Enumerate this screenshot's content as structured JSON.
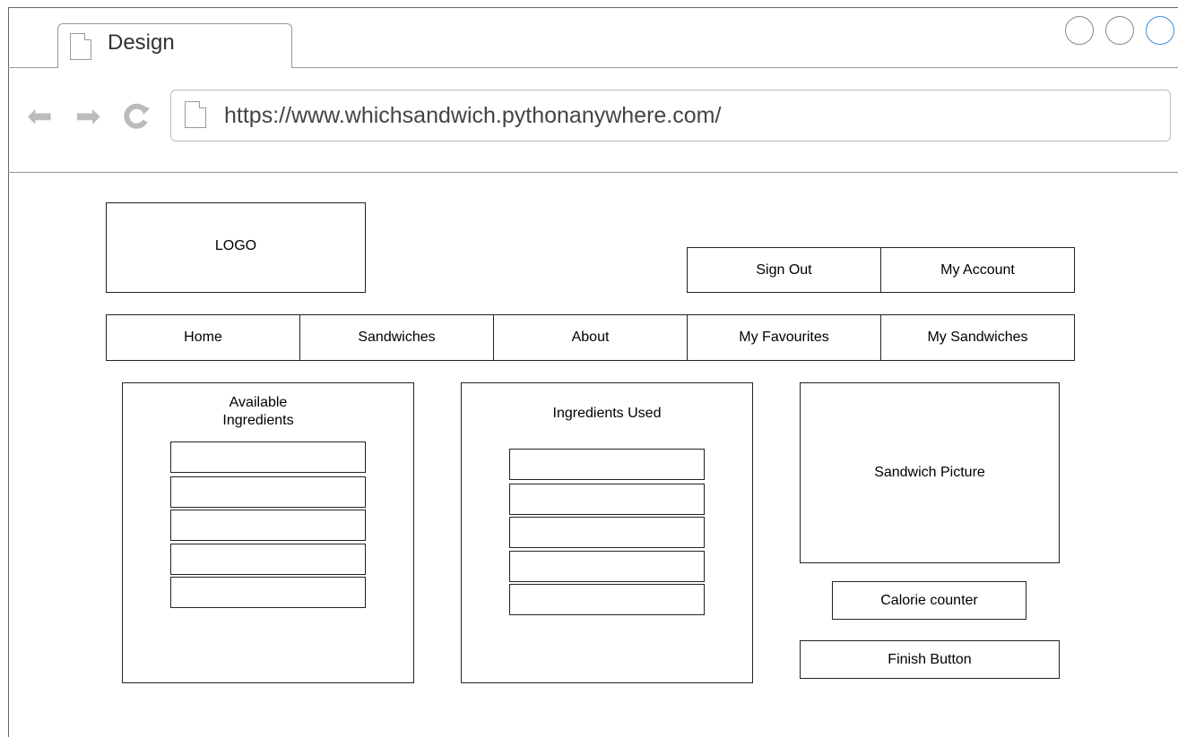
{
  "browser": {
    "tab_title": "Design",
    "url": "https://www.whichsandwich.pythonanywhere.com/"
  },
  "page": {
    "logo_label": "LOGO",
    "header_buttons": [
      "Sign Out",
      "My Account"
    ],
    "nav_items": [
      "Home",
      "Sandwiches",
      "About",
      "My Favourites",
      "My Sandwiches"
    ],
    "available_panel": {
      "title": "Available Ingredients",
      "slots": [
        "",
        "",
        "",
        "",
        ""
      ]
    },
    "used_panel": {
      "title": "Ingredients Used",
      "slots": [
        "",
        "",
        "",
        "",
        ""
      ]
    },
    "picture_label": "Sandwich Picture",
    "calorie_label": "Calorie counter",
    "finish_label": "Finish Button"
  }
}
